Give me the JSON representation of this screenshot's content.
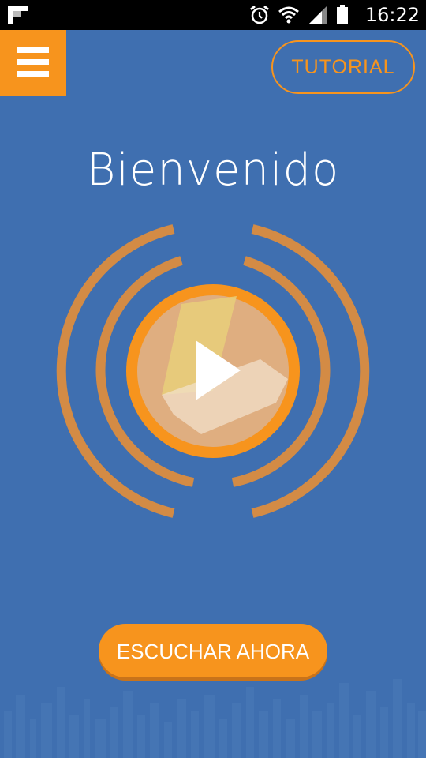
{
  "status_bar": {
    "time": "16:22",
    "icons": [
      "notification-flipboard-icon",
      "alarm-icon",
      "wifi-icon",
      "signal-icon",
      "battery-icon"
    ]
  },
  "header": {
    "menu_icon": "hamburger-menu-icon",
    "tutorial_label": "TUTORIAL"
  },
  "main": {
    "title": "Bienvenido",
    "play_icon": "play-icon",
    "listen_label": "ESCUCHAR AHORA"
  },
  "colors": {
    "background": "#3f6fb0",
    "accent": "#f7941d",
    "rings": "#d38b45",
    "status_bar": "#000000",
    "text": "#ffffff"
  }
}
